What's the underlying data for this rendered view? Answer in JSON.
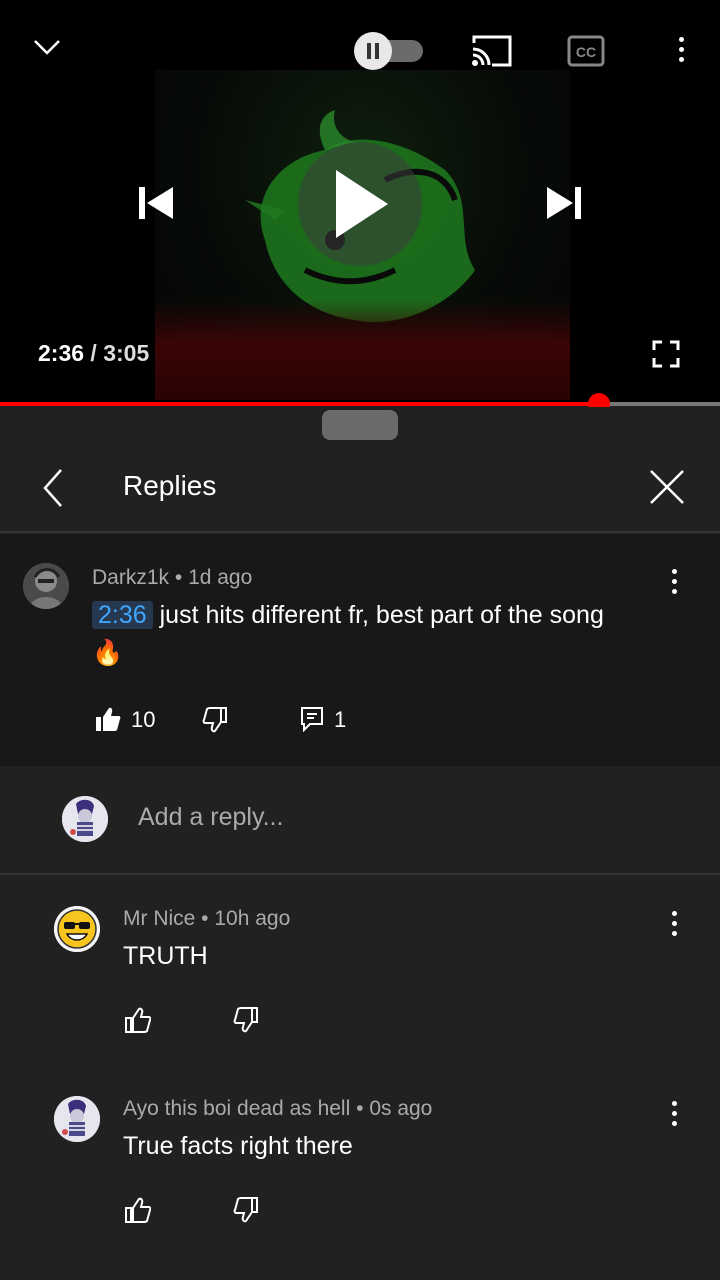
{
  "player": {
    "current_time": "2:36",
    "separator": " / ",
    "duration": "3:05",
    "progress_percent": 83.2
  },
  "sheet": {
    "title": "Replies"
  },
  "parent_comment": {
    "author": "Darkz1k",
    "age": "1d ago",
    "timestamp_link": "2:36",
    "text": " just hits different fr, best part of the song",
    "emoji": "🔥",
    "likes": "10",
    "replies": "1"
  },
  "reply_box": {
    "placeholder": "Add a reply..."
  },
  "replies": [
    {
      "author": "Mr Nice",
      "age": "10h ago",
      "text": "TRUTH"
    },
    {
      "author": "Ayo this boi dead as hell",
      "age": "0s ago",
      "text": "True facts right there"
    }
  ],
  "colors": {
    "accent_red": "#ff0000",
    "timestamp_blue": "#3ea6ff",
    "sheet_bg": "#212121"
  }
}
